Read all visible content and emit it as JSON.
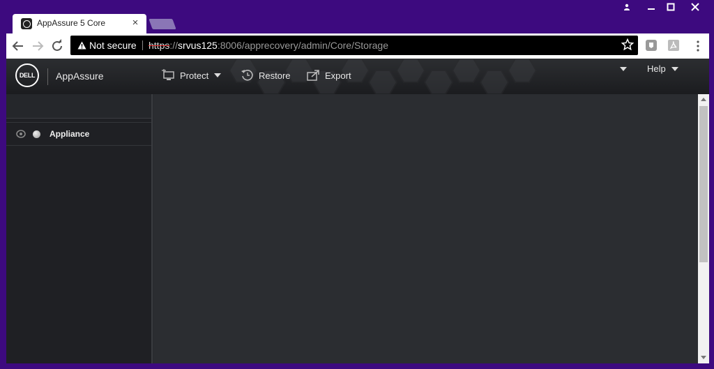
{
  "browser": {
    "tab_title": "AppAssure 5 Core",
    "tab_close": "×",
    "security_label": "Not secure",
    "url": {
      "scheme": "https",
      "separator": "://",
      "host": "srvus125",
      "path": ":8006/apprecovery/admin/Core/Storage"
    },
    "window_controls": {
      "minimize": "—",
      "maximize": "□",
      "close": "✕"
    },
    "icons": [
      "back-icon",
      "forward-icon",
      "reload-icon",
      "warning-icon",
      "star-icon",
      "extension-icon",
      "pdf-icon",
      "menu-icon"
    ]
  },
  "app": {
    "logo_text": "DELL",
    "name": "AppAssure",
    "menu": {
      "protect": "Protect",
      "restore": "Restore",
      "export": "Export",
      "help": "Help"
    }
  },
  "sidebar": {
    "items": [
      {
        "label": "Appliance"
      }
    ]
  },
  "colors": {
    "window_frame": "#3d0a7f",
    "header_bg": "#1b1c1f",
    "sidebar_bg": "#1f2024",
    "main_bg": "#2b2d31"
  }
}
